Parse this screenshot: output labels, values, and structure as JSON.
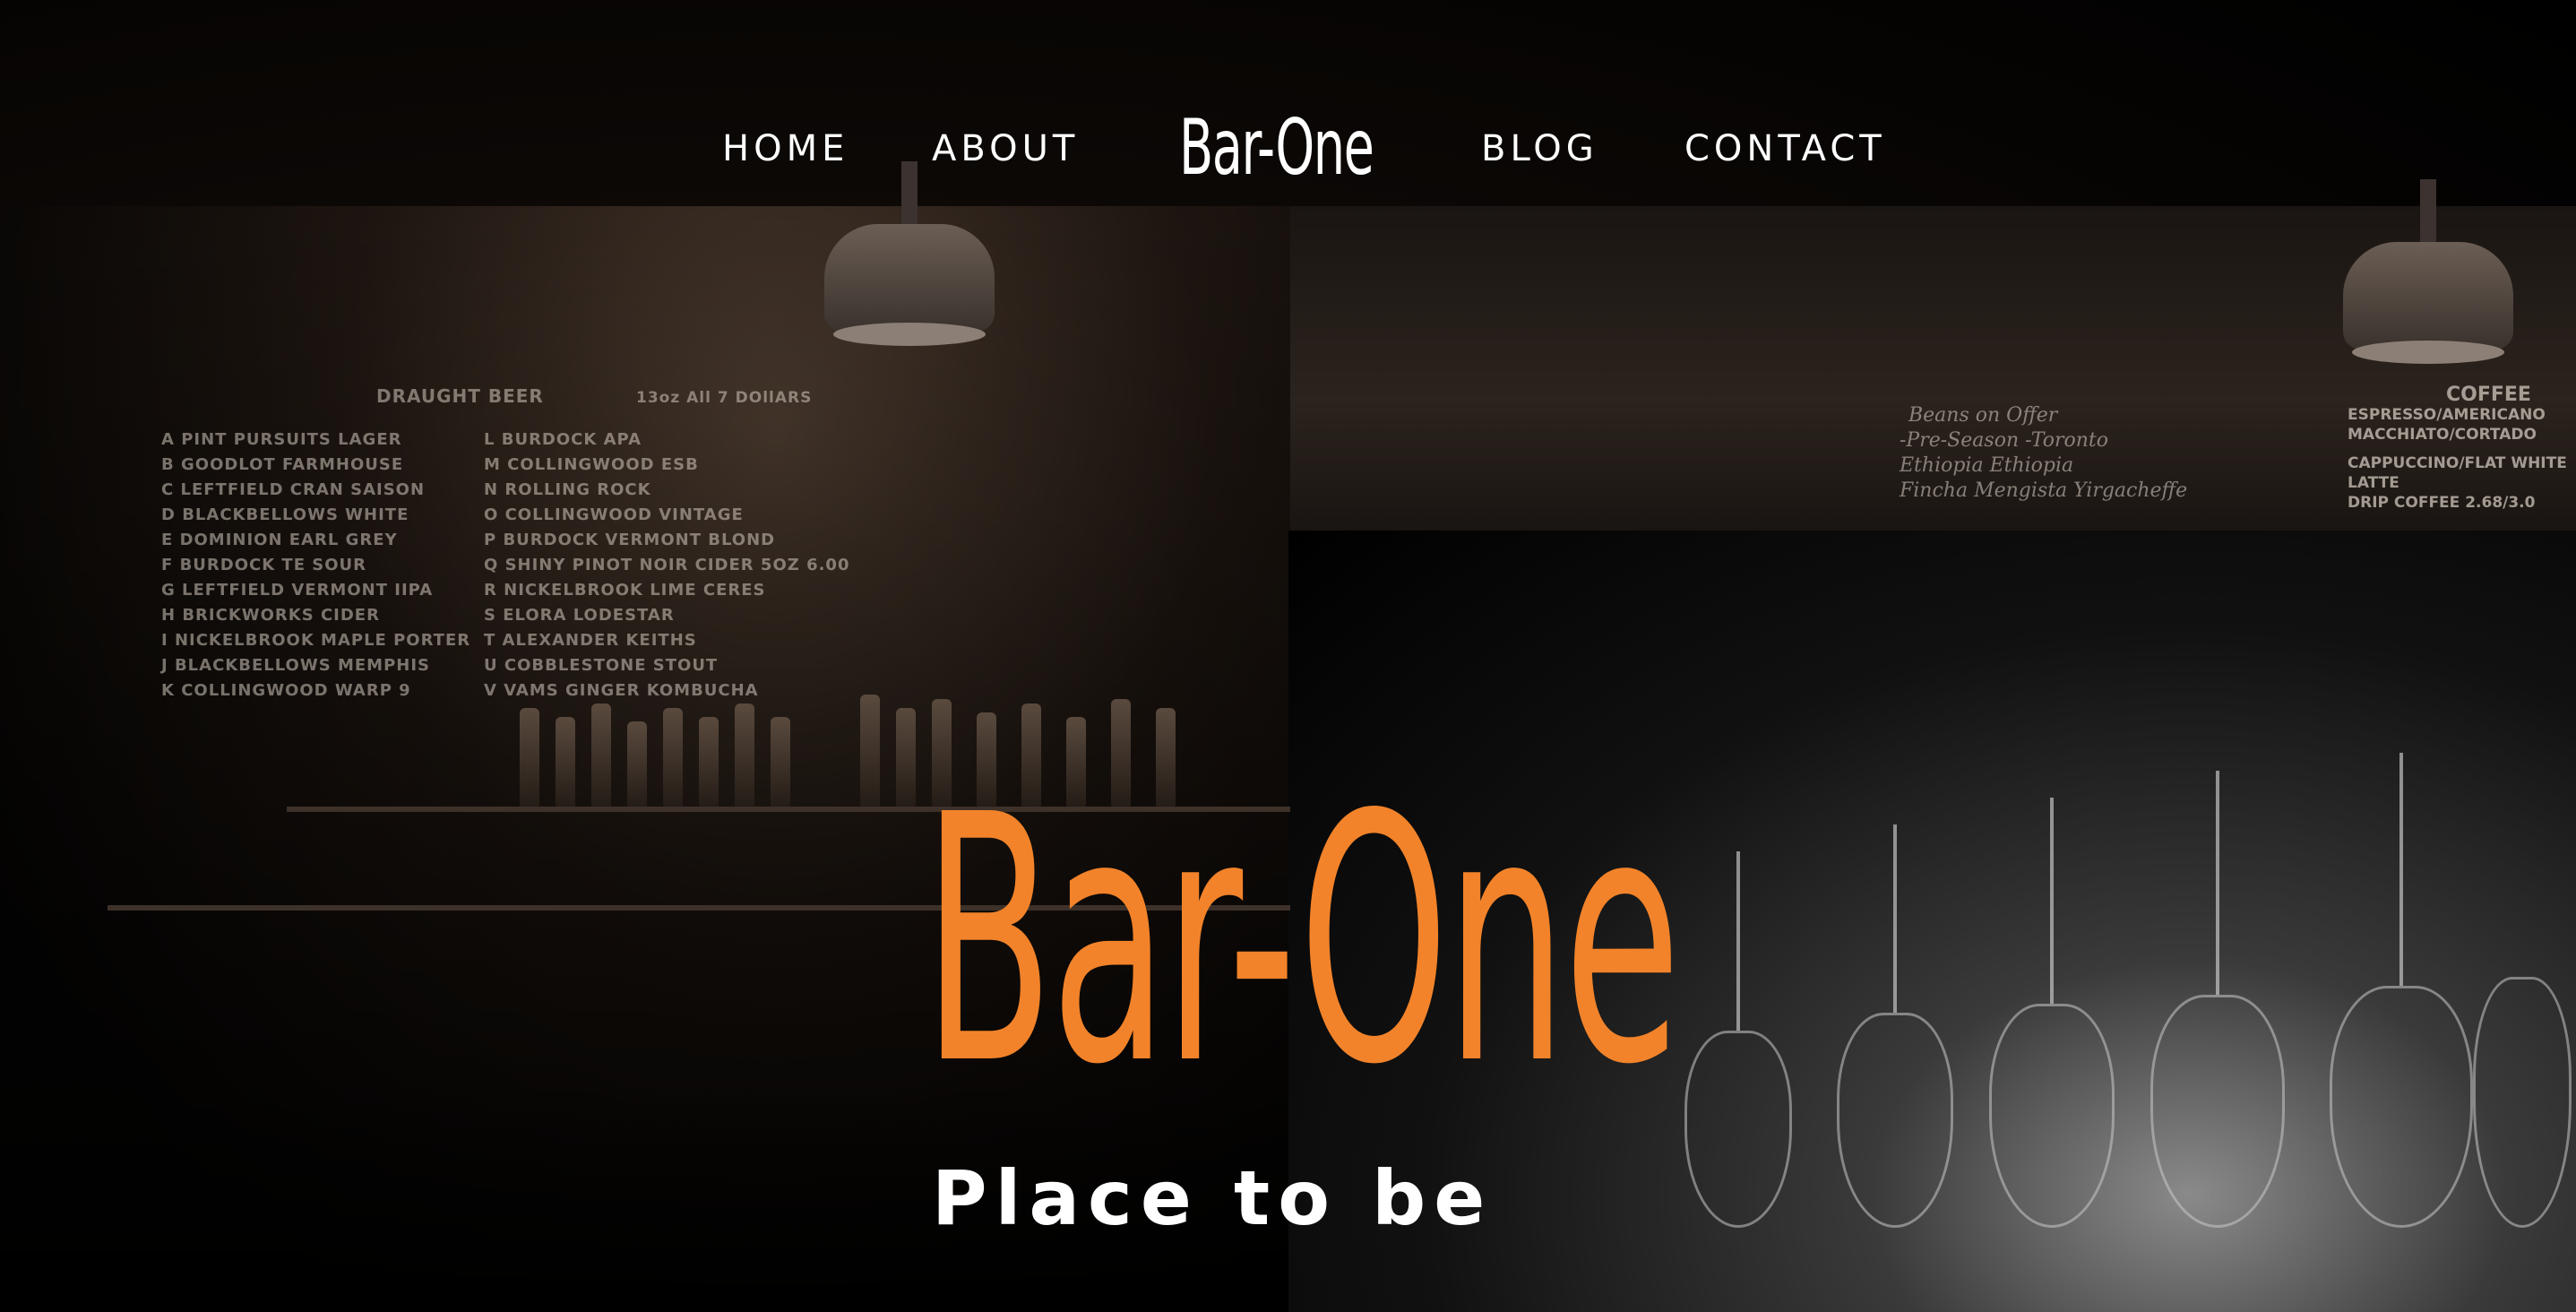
{
  "nav": {
    "home_label": "HOME",
    "about_label": "ABOUT",
    "logo_label": "Bar-One",
    "blog_label": "BLOG",
    "contact_label": "CONTACT"
  },
  "hero": {
    "title": "Bar-One",
    "tagline": "Place to be"
  },
  "board": {
    "title": "DRAUGHT  BEER",
    "price": "13oz   All 7 DOllARS",
    "left_items": [
      "A  PINT PURSUITS  LAGER",
      "B GOODLOT     FARMHOUSE",
      "C LEFTFIELD CRAN  SAISON",
      "D BLACKBELLOWS   WHITE",
      "E DOMINION EARL  GREY",
      "F  BURDOCK  TE    SOUR",
      "G  LEFTFIELD  VERMONT  IIPA",
      "H BRICKWORKS   CIDER",
      "I  NICKELBROOK MAPLE PORTER",
      "J BLACKBELLOWS MEMPHIS",
      "K COLLINGWOOD  WARP 9"
    ],
    "right_items": [
      "L  BURDOCK   APA",
      "M COLLINGWOOD  ESB",
      "N  ROLLING ROCK",
      "O  COLLINGWOOD  VINTAGE",
      "P  BURDOCK VERMONT BLOND",
      "Q  SHINY PINOT NOIR CIDER  5OZ    6.00",
      "R  NICKELBROOK  LIME  CERES",
      "S  ELORA  LODESTAR",
      "T ALEXANDER   KEITHS",
      "U COBBLESTONE  STOUT",
      "V  VAMS GINGER KOMBUCHA"
    ]
  },
  "coffee_board": {
    "title": "COFFEE",
    "lines": [
      "ESPRESSO/AMERICANO",
      "MACCHIATO/CORTADO",
      "CAPPUCCINO/FLAT WHITE",
      "LATTE",
      "DRIP COFFEE    2.68/3.0"
    ]
  },
  "beans_board": {
    "title": "Beans on Offer",
    "lines": [
      "-Pre-Season      -Toronto",
      " Ethiopia         Ethiopia",
      " Fincha Mengista  Yirgacheffe"
    ]
  },
  "colors": {
    "accent": "#f2832a",
    "text": "#ffffff",
    "background": "#000000"
  }
}
